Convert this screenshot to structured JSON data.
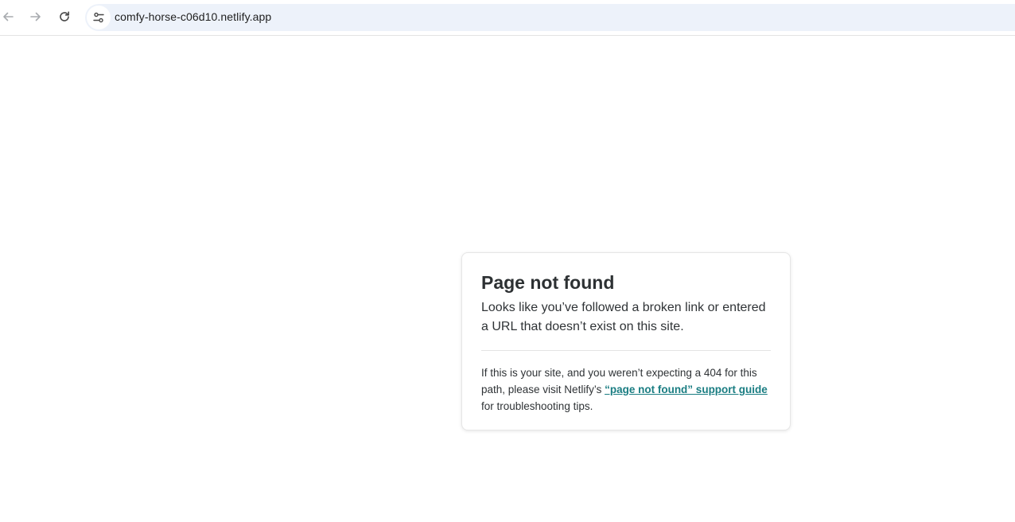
{
  "browser": {
    "url": "comfy-horse-c06d10.netlify.app",
    "icons": {
      "back": "arrow-left-icon",
      "forward": "arrow-right-icon",
      "reload": "reload-icon",
      "site_info": "tune-icon"
    },
    "colors": {
      "omnibox_bg": "#edf2fa",
      "icon": "#5f6368"
    }
  },
  "card": {
    "title": "Page not found",
    "lead": "Looks like you’ve followed a broken link or entered a URL that doesn’t exist on this site.",
    "help_before": "If this is your site, and you weren’t expecting a 404 for this path, please visit Netlify’s ",
    "help_link": "“page not found” support guide",
    "help_after": " for troubleshooting tips.",
    "colors": {
      "link": "#1a7d82",
      "text": "#2f3336"
    }
  }
}
